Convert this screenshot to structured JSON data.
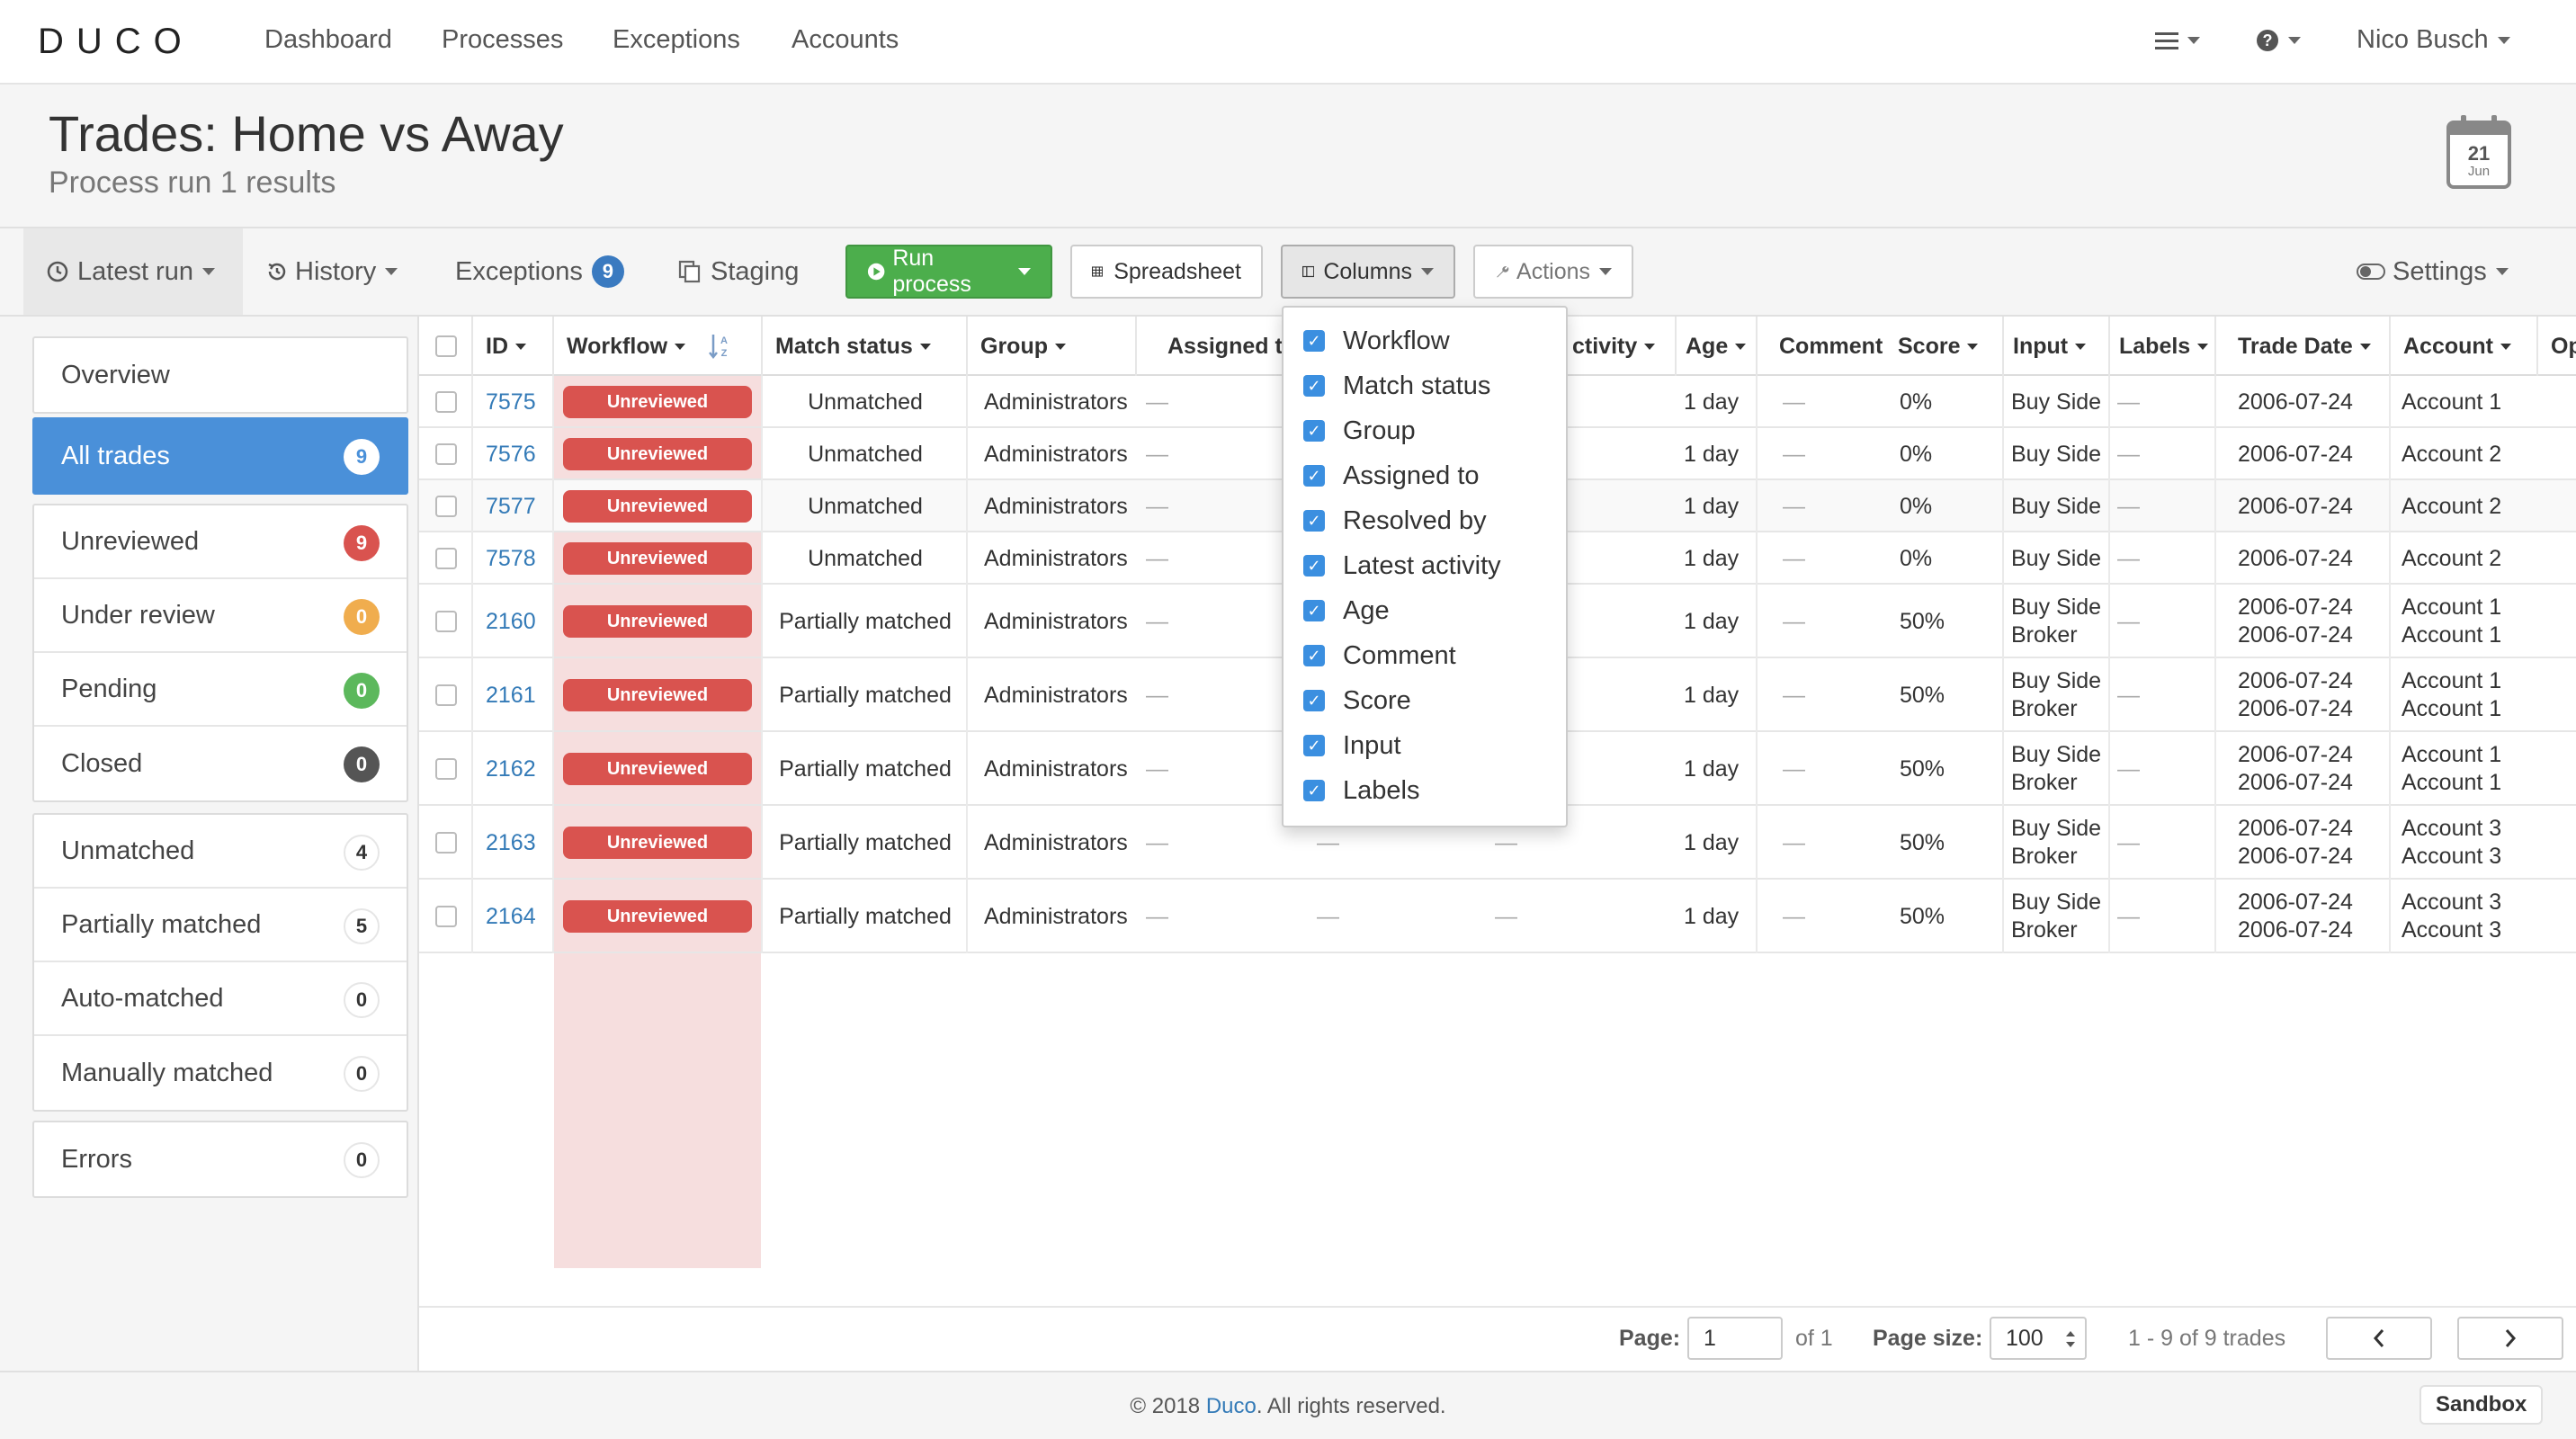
{
  "brand": {
    "logo": "DUCO"
  },
  "nav": {
    "links": [
      "Dashboard",
      "Processes",
      "Exceptions",
      "Accounts"
    ],
    "user": "Nico Busch"
  },
  "header": {
    "title": "Trades: Home vs Away",
    "subtitle": "Process run 1 results",
    "calendar_day": "21",
    "calendar_month": "Jun"
  },
  "toolbar": {
    "latest_run": "Latest run",
    "history": "History",
    "exceptions": "Exceptions",
    "exceptions_count": "9",
    "staging": "Staging",
    "run_process": "Run process",
    "spreadsheet": "Spreadsheet",
    "columns": "Columns",
    "actions": "Actions",
    "settings": "Settings"
  },
  "sidebar": {
    "overview": "Overview",
    "status_items": [
      {
        "label": "All trades",
        "count": "9"
      },
      {
        "label": "Unreviewed",
        "count": "9"
      },
      {
        "label": "Under review",
        "count": "0"
      },
      {
        "label": "Pending",
        "count": "0"
      },
      {
        "label": "Closed",
        "count": "0"
      }
    ],
    "match_items": [
      {
        "label": "Unmatched",
        "count": "4"
      },
      {
        "label": "Partially matched",
        "count": "5"
      },
      {
        "label": "Auto-matched",
        "count": "0"
      },
      {
        "label": "Manually matched",
        "count": "0"
      }
    ],
    "errors": {
      "label": "Errors",
      "count": "0"
    }
  },
  "table": {
    "headers": {
      "id": "ID",
      "workflow": "Workflow",
      "match_status": "Match status",
      "group": "Group",
      "assigned_to": "Assigned to",
      "latest_activity": "ctivity",
      "age": "Age",
      "comment": "Comment",
      "score": "Score",
      "input": "Input",
      "labels": "Labels",
      "trade_date": "Trade Date",
      "account": "Account",
      "options": "Opt"
    },
    "dash": "—",
    "rows": [
      {
        "id": "7575",
        "workflow": "Unreviewed",
        "match": "Unmatched",
        "group": "Administrators",
        "age": "1 day",
        "score": "0%",
        "input1": "Buy Side",
        "input2": "",
        "date1": "2006-07-24",
        "date2": "",
        "account1": "Account 1",
        "account2": ""
      },
      {
        "id": "7576",
        "workflow": "Unreviewed",
        "match": "Unmatched",
        "group": "Administrators",
        "age": "1 day",
        "score": "0%",
        "input1": "Buy Side",
        "input2": "",
        "date1": "2006-07-24",
        "date2": "",
        "account1": "Account 2",
        "account2": ""
      },
      {
        "id": "7577",
        "workflow": "Unreviewed",
        "match": "Unmatched",
        "group": "Administrators",
        "age": "1 day",
        "score": "0%",
        "input1": "Buy Side",
        "input2": "",
        "date1": "2006-07-24",
        "date2": "",
        "account1": "Account 2",
        "account2": ""
      },
      {
        "id": "7578",
        "workflow": "Unreviewed",
        "match": "Unmatched",
        "group": "Administrators",
        "age": "1 day",
        "score": "0%",
        "input1": "Buy Side",
        "input2": "",
        "date1": "2006-07-24",
        "date2": "",
        "account1": "Account 2",
        "account2": ""
      },
      {
        "id": "2160",
        "workflow": "Unreviewed",
        "match": "Partially matched",
        "group": "Administrators",
        "age": "1 day",
        "score": "50%",
        "input1": "Buy Side",
        "input2": "Broker",
        "date1": "2006-07-24",
        "date2": "2006-07-24",
        "account1": "Account 1",
        "account2": "Account 1"
      },
      {
        "id": "2161",
        "workflow": "Unreviewed",
        "match": "Partially matched",
        "group": "Administrators",
        "age": "1 day",
        "score": "50%",
        "input1": "Buy Side",
        "input2": "Broker",
        "date1": "2006-07-24",
        "date2": "2006-07-24",
        "account1": "Account 1",
        "account2": "Account 1"
      },
      {
        "id": "2162",
        "workflow": "Unreviewed",
        "match": "Partially matched",
        "group": "Administrators",
        "age": "1 day",
        "score": "50%",
        "input1": "Buy Side",
        "input2": "Broker",
        "date1": "2006-07-24",
        "date2": "2006-07-24",
        "account1": "Account 1",
        "account2": "Account 1"
      },
      {
        "id": "2163",
        "workflow": "Unreviewed",
        "match": "Partially matched",
        "group": "Administrators",
        "age": "1 day",
        "score": "50%",
        "input1": "Buy Side",
        "input2": "Broker",
        "date1": "2006-07-24",
        "date2": "2006-07-24",
        "account1": "Account 3",
        "account2": "Account 3"
      },
      {
        "id": "2164",
        "workflow": "Unreviewed",
        "match": "Partially matched",
        "group": "Administrators",
        "age": "1 day",
        "score": "50%",
        "input1": "Buy Side",
        "input2": "Broker",
        "date1": "2006-07-24",
        "date2": "2006-07-24",
        "account1": "Account 3",
        "account2": "Account 3"
      }
    ]
  },
  "columns_menu": {
    "items": [
      "Workflow",
      "Match status",
      "Group",
      "Assigned to",
      "Resolved by",
      "Latest activity",
      "Age",
      "Comment",
      "Score",
      "Input",
      "Labels"
    ]
  },
  "pagination": {
    "page_label": "Page:",
    "page_value": "1",
    "of_text": "of 1",
    "page_size_label": "Page size:",
    "page_size_value": "100",
    "summary": "1 - 9 of 9 trades"
  },
  "footer": {
    "copyright_prefix": "© 2018 ",
    "brand_link": "Duco",
    "copyright_suffix": ". All rights reserved.",
    "env_badge": "Sandbox"
  },
  "colors": {
    "primary_blue": "#4a90d9",
    "run_green": "#4cae4c",
    "unreviewed_red": "#d9534f",
    "link_blue": "#337ab7"
  }
}
